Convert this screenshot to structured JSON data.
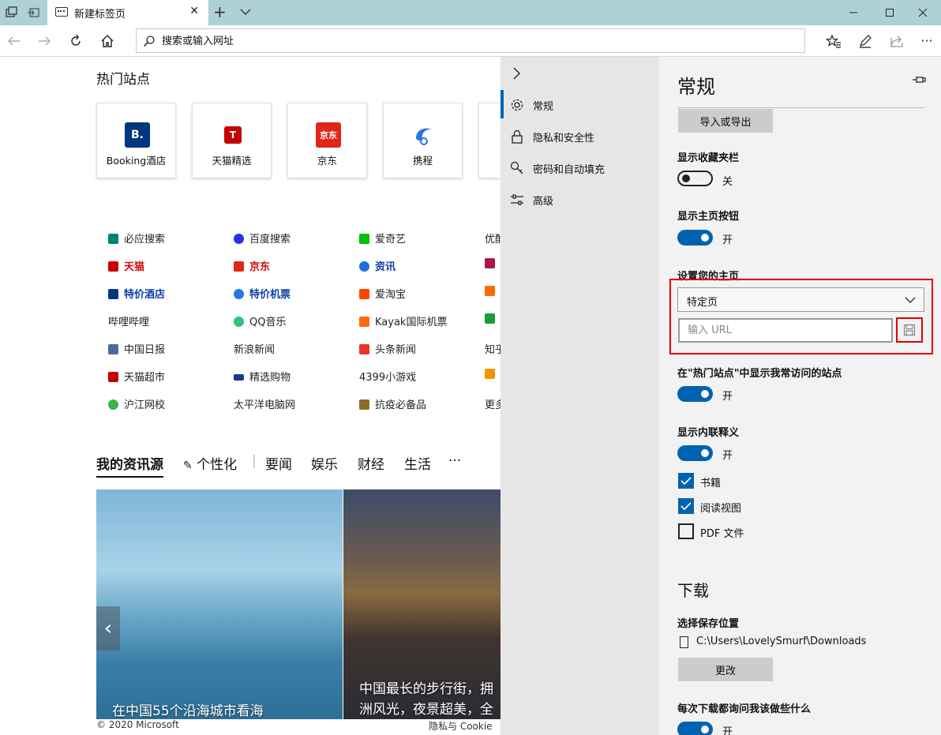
{
  "browser": {
    "tab_title": "新建标签页",
    "address_placeholder": "搜索或输入网址"
  },
  "top_sites": {
    "title": "热门站点",
    "tiles": [
      {
        "label": "Booking酒店",
        "logo_text": "B.",
        "color": "#003580"
      },
      {
        "label": "天猫精选",
        "logo_text": "T",
        "color": "#c40000"
      },
      {
        "label": "京东",
        "logo_text": "京东",
        "color": "#e1251b"
      },
      {
        "label": "携程",
        "logo_text": "",
        "color": "#2577e3"
      }
    ]
  },
  "quick_links": [
    [
      {
        "label": "必应搜索",
        "icon": "bing-icon",
        "color": "#008373",
        "style": ""
      },
      {
        "label": "天猫",
        "icon": "tmall-icon",
        "color": "#c40000",
        "style": "red"
      },
      {
        "label": "特价酒店",
        "icon": "booking-icon",
        "color": "#003580",
        "style": "blue"
      },
      {
        "label": "哔哩哔哩",
        "icon": "",
        "color": "",
        "style": ""
      },
      {
        "label": "中国日报",
        "icon": "chinadaily-icon",
        "color": "#4a6b9a",
        "style": ""
      },
      {
        "label": "天猫超市",
        "icon": "tmall-market-icon",
        "color": "#c40000",
        "style": ""
      },
      {
        "label": "沪江网校",
        "icon": "hujiang-icon",
        "color": "#36b34a",
        "style": ""
      }
    ],
    [
      {
        "label": "百度搜索",
        "icon": "baidu-icon",
        "color": "#2932e1",
        "style": ""
      },
      {
        "label": "京东",
        "icon": "jd-icon",
        "color": "#e1251b",
        "style": "red"
      },
      {
        "label": "特价机票",
        "icon": "ctrip-icon",
        "color": "#2577e3",
        "style": "blue"
      },
      {
        "label": "QQ音乐",
        "icon": "qqmusic-icon",
        "color": "#31c27c",
        "style": ""
      },
      {
        "label": "新浪新闻",
        "icon": "",
        "color": "",
        "style": ""
      },
      {
        "label": "精选购物",
        "icon": "cart-icon",
        "color": "#1a3a8a",
        "style": ""
      },
      {
        "label": "太平洋电脑网",
        "icon": "",
        "color": "",
        "style": ""
      }
    ],
    [
      {
        "label": "爱奇艺",
        "icon": "iqiyi-icon",
        "color": "#00be06",
        "style": ""
      },
      {
        "label": "资讯",
        "icon": "news-icon",
        "color": "#1e6fd9",
        "style": "blue"
      },
      {
        "label": "爱淘宝",
        "icon": "aitaobao-icon",
        "color": "#ff4400",
        "style": ""
      },
      {
        "label": "Kayak国际机票",
        "icon": "kayak-icon",
        "color": "#ff690f",
        "style": ""
      },
      {
        "label": "头条新闻",
        "icon": "toutiao-icon",
        "color": "#e8332a",
        "style": ""
      },
      {
        "label": "4399小游戏",
        "icon": "",
        "color": "",
        "style": ""
      },
      {
        "label": "抗疫必备品",
        "icon": "mask-icon",
        "color": "#8a6d2a",
        "style": ""
      }
    ],
    [
      {
        "label": "优酷",
        "icon": "",
        "color": "",
        "style": ""
      },
      {
        "label": "",
        "icon": "site-icon",
        "color": "#a8184c",
        "style": ""
      },
      {
        "label": "",
        "icon": "site-icon",
        "color": "#ff6a00",
        "style": ""
      },
      {
        "label": "",
        "icon": "site-icon",
        "color": "#1a9a3a",
        "style": ""
      },
      {
        "label": "知乎",
        "icon": "",
        "color": "",
        "style": ""
      },
      {
        "label": "",
        "icon": "58-icon",
        "color": "#f29400",
        "style": ""
      },
      {
        "label": "更多",
        "icon": "",
        "color": "",
        "style": ""
      }
    ]
  ],
  "feed": {
    "tabs": {
      "my": "我的资讯源",
      "personalize": "个性化",
      "news": "要闻",
      "ent": "娱乐",
      "finance": "财经",
      "life": "生活",
      "more": "···"
    },
    "cards": [
      {
        "title": "在中国55个沿海城市看海"
      },
      {
        "title": "中国最长的步行街，拥",
        "title2": "洲风光，夜景超美，全"
      }
    ]
  },
  "footer": {
    "copyright": "© 2020 Microsoft",
    "privacy": "隐私与 Cookie"
  },
  "settings_nav": [
    {
      "label": "常规",
      "icon": "gear-icon"
    },
    {
      "label": "隐私和安全性",
      "icon": "lock-icon"
    },
    {
      "label": "密码和自动填充",
      "icon": "key-icon"
    },
    {
      "label": "高级",
      "icon": "sliders-icon"
    }
  ],
  "settings": {
    "title": "常规",
    "import_export": "导入或导出",
    "favorites_bar": {
      "label": "显示收藏夹栏",
      "state": "关"
    },
    "home_button": {
      "label": "显示主页按钮",
      "state": "开"
    },
    "homepage": {
      "label": "设置您的主页",
      "selected": "特定页",
      "url_placeholder": "输入 URL"
    },
    "top_sites_toggle": {
      "label": "在\"热门站点\"中显示我常访问的站点",
      "state": "开"
    },
    "inline_define": {
      "label": "显示内联释义",
      "state": "开"
    },
    "checks": [
      {
        "label": "书籍",
        "checked": true
      },
      {
        "label": "阅读视图",
        "checked": true
      },
      {
        "label": "PDF 文件",
        "checked": false
      }
    ],
    "downloads": {
      "title": "下载",
      "location_label": "选择保存位置",
      "path": "C:\\Users\\LovelySmurf\\Downloads",
      "change": "更改",
      "ask_label": "每次下载都询问我该做些什么",
      "ask_state": "开"
    }
  },
  "colors": {
    "accent": "#0063b1",
    "highlight": "#e00000",
    "titlebar": "#aed1d5"
  }
}
